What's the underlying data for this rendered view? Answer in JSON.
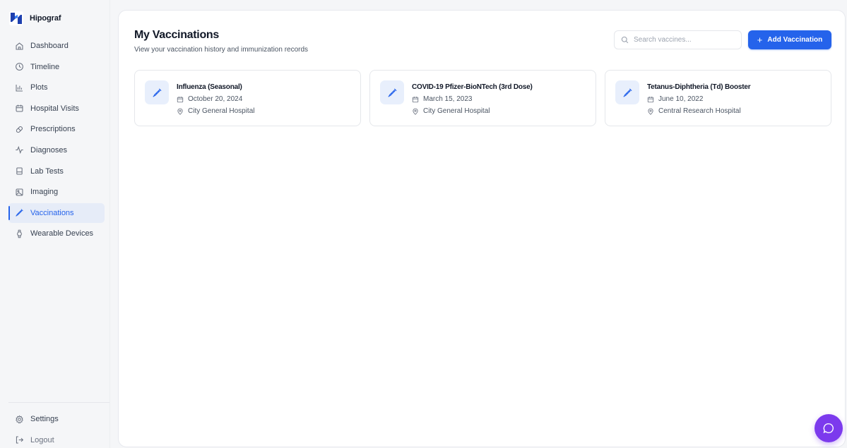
{
  "app": {
    "name": "Hipograf"
  },
  "sidebar": {
    "items": [
      {
        "label": "Dashboard",
        "icon": "home-icon",
        "active": false
      },
      {
        "label": "Timeline",
        "icon": "clock-icon",
        "active": false
      },
      {
        "label": "Plots",
        "icon": "bar-chart-icon",
        "active": false
      },
      {
        "label": "Hospital Visits",
        "icon": "calendar-icon",
        "active": false
      },
      {
        "label": "Prescriptions",
        "icon": "pill-icon",
        "active": false
      },
      {
        "label": "Diagnoses",
        "icon": "activity-icon",
        "active": false
      },
      {
        "label": "Lab Tests",
        "icon": "test-tube-icon",
        "active": false
      },
      {
        "label": "Imaging",
        "icon": "image-icon",
        "active": true
      },
      {
        "label": "Vaccinations",
        "icon": "syringe-icon",
        "active": true
      },
      {
        "label": "Wearable Devices",
        "icon": "watch-icon",
        "active": false
      }
    ],
    "footer": [
      {
        "label": "Settings",
        "icon": "gear-icon"
      },
      {
        "label": "Logout",
        "icon": "logout-icon"
      }
    ]
  },
  "header": {
    "title": "My Vaccinations",
    "subtitle": "View your vaccination history and immunization records",
    "search_placeholder": "Search vaccines...",
    "add_label": "Add Vaccination"
  },
  "vaccinations": [
    {
      "name": "Influenza (Seasonal)",
      "date": "October 20, 2024",
      "location": "City General Hospital"
    },
    {
      "name": "COVID-19 Pfizer-BioNTech (3rd Dose)",
      "date": "March 15, 2023",
      "location": "City General Hospital"
    },
    {
      "name": "Tetanus-Diphtheria (Td) Booster",
      "date": "June 10, 2022",
      "location": "Central Research Hospital"
    }
  ],
  "colors": {
    "accent": "#2563eb",
    "active_bg": "#e6ecf8",
    "icon_bg": "#e8effc",
    "chat_button": "#7c3aed"
  }
}
